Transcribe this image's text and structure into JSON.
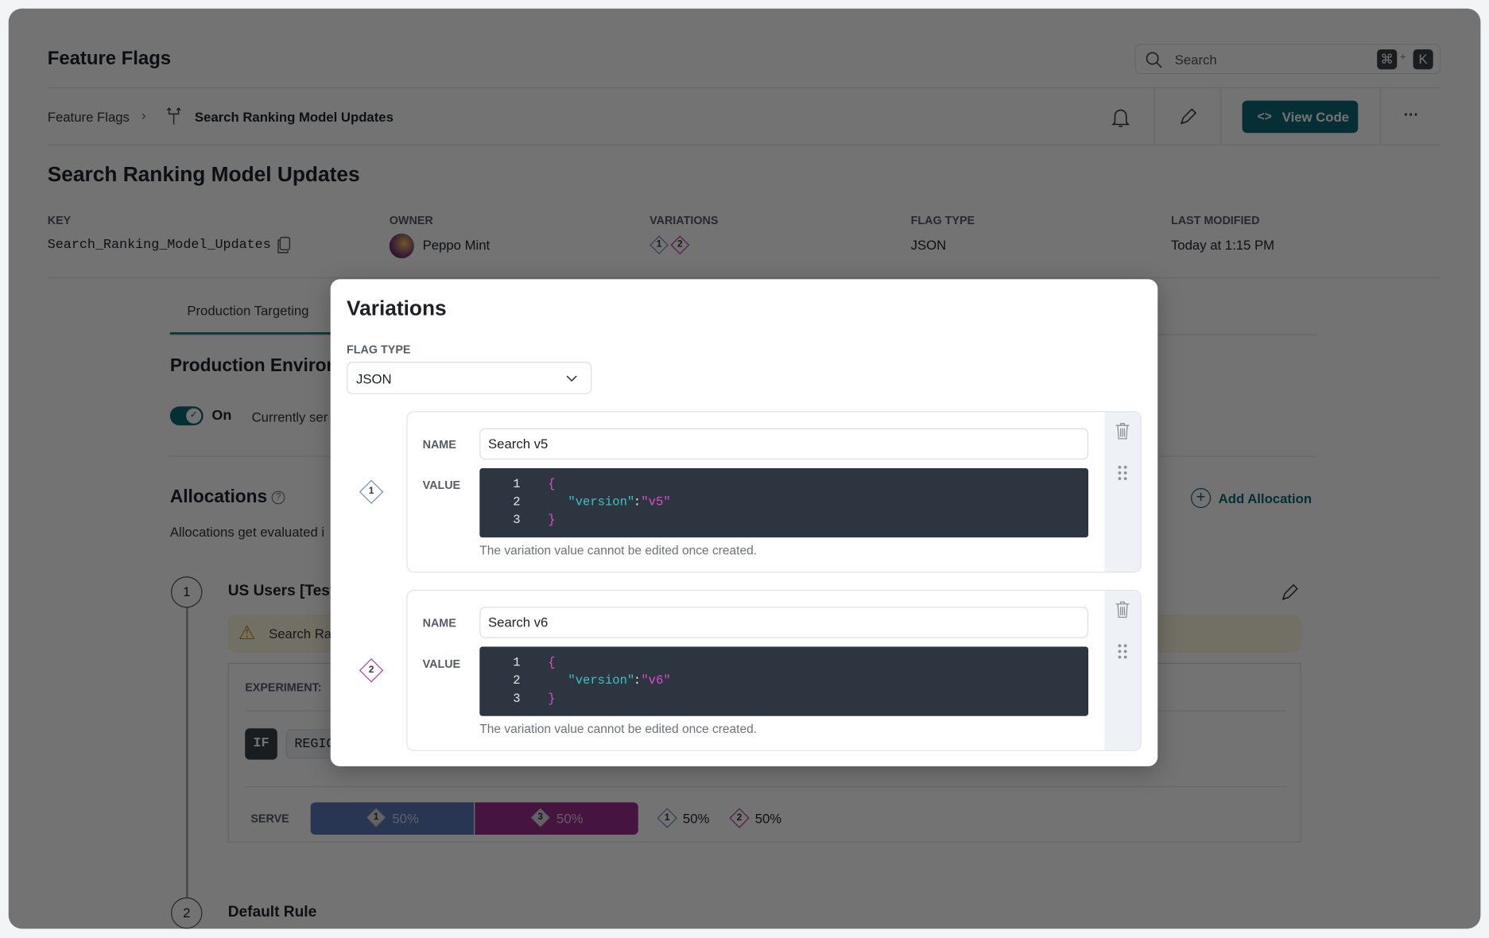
{
  "app": {
    "title": "Feature Flags",
    "search_placeholder": "Search",
    "shortcut_cmd": "⌘",
    "shortcut_plus": "+",
    "shortcut_key": "K"
  },
  "breadcrumb": {
    "root": "Feature Flags",
    "current": "Search Ranking Model Updates"
  },
  "toolbar": {
    "view_code": "View Code",
    "more": "···"
  },
  "flag": {
    "title": "Search Ranking Model Updates",
    "meta": {
      "key_label": "KEY",
      "key": "Search_Ranking_Model_Updates",
      "owner_label": "OWNER",
      "owner": "Peppo Mint",
      "variations_label": "VARIATIONS",
      "variation_1": "1",
      "variation_2": "2",
      "flag_type_label": "FLAG TYPE",
      "flag_type": "JSON",
      "last_modified_label": "LAST MODIFIED",
      "last_modified": "Today at 1:15 PM"
    }
  },
  "tabs": [
    {
      "label": "Production Targeting",
      "active": true
    }
  ],
  "environment": {
    "title": "Production Environ",
    "toggle_label": "On",
    "toggle_on": true,
    "status": "Currently ser"
  },
  "allocations": {
    "title": "Allocations",
    "description": "Allocations get evaluated i",
    "add_label": "Add Allocation",
    "rules": [
      {
        "index": "1",
        "name": "US Users [Test",
        "warning": "Search Ra",
        "experiment_label": "EXPERIMENT:",
        "if_label": "IF",
        "condition": "REGIO",
        "serve_label": "SERVE",
        "serve": [
          {
            "variation": "1",
            "percent": "50%",
            "color": "#5a79b8"
          },
          {
            "variation": "3",
            "percent": "50%",
            "color": "#9a2e8e"
          }
        ],
        "legend": [
          {
            "variation": "1",
            "percent": "50%"
          },
          {
            "variation": "2",
            "percent": "50%"
          }
        ]
      },
      {
        "index": "2",
        "name": "Default Rule"
      }
    ]
  },
  "modal": {
    "title": "Variations",
    "flag_type_label": "FLAG TYPE",
    "flag_type_value": "JSON",
    "name_label": "NAME",
    "value_label": "VALUE",
    "variations": [
      {
        "index": "1",
        "name": "Search v5",
        "code": [
          "{",
          "\"version\"",
          ":",
          "\"v5\"",
          "}"
        ],
        "help": "The variation value cannot be edited once created.",
        "color": "#6b8cc9"
      },
      {
        "index": "2",
        "name": "Search v6",
        "code": [
          "{",
          "\"version\"",
          ":",
          "\"v6\"",
          "}"
        ],
        "help": "The variation value cannot be edited once created.",
        "color": "#b03ea6"
      }
    ]
  },
  "colors": {
    "accent": "#0d5f6b",
    "code_bg": "#2d3640",
    "code_key": "#3cc3c3",
    "code_punct": "#e04cc8"
  }
}
